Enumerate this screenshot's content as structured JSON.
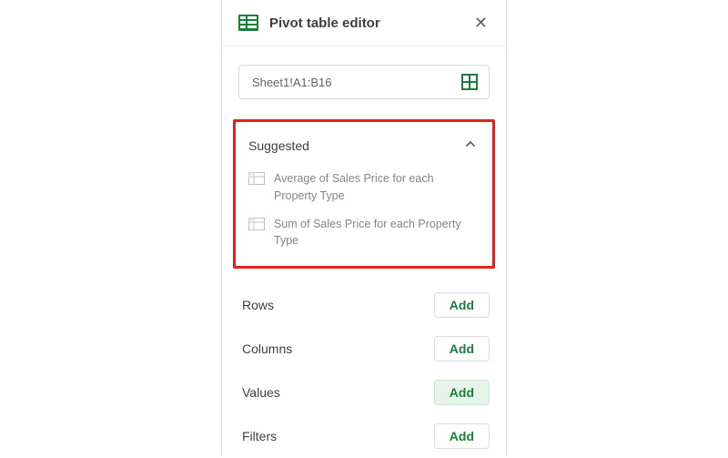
{
  "header": {
    "title": "Pivot table editor"
  },
  "range": {
    "value": "Sheet1!A1:B16"
  },
  "suggested": {
    "label": "Suggested",
    "items": [
      "Average of Sales Price for each Property Type",
      "Sum of Sales Price for each Property Type"
    ]
  },
  "sections": {
    "rows": {
      "label": "Rows",
      "button": "Add"
    },
    "columns": {
      "label": "Columns",
      "button": "Add"
    },
    "values": {
      "label": "Values",
      "button": "Add"
    },
    "filters": {
      "label": "Filters",
      "button": "Add"
    }
  },
  "colors": {
    "accent": "#188038",
    "highlight_border": "#e2231a"
  }
}
